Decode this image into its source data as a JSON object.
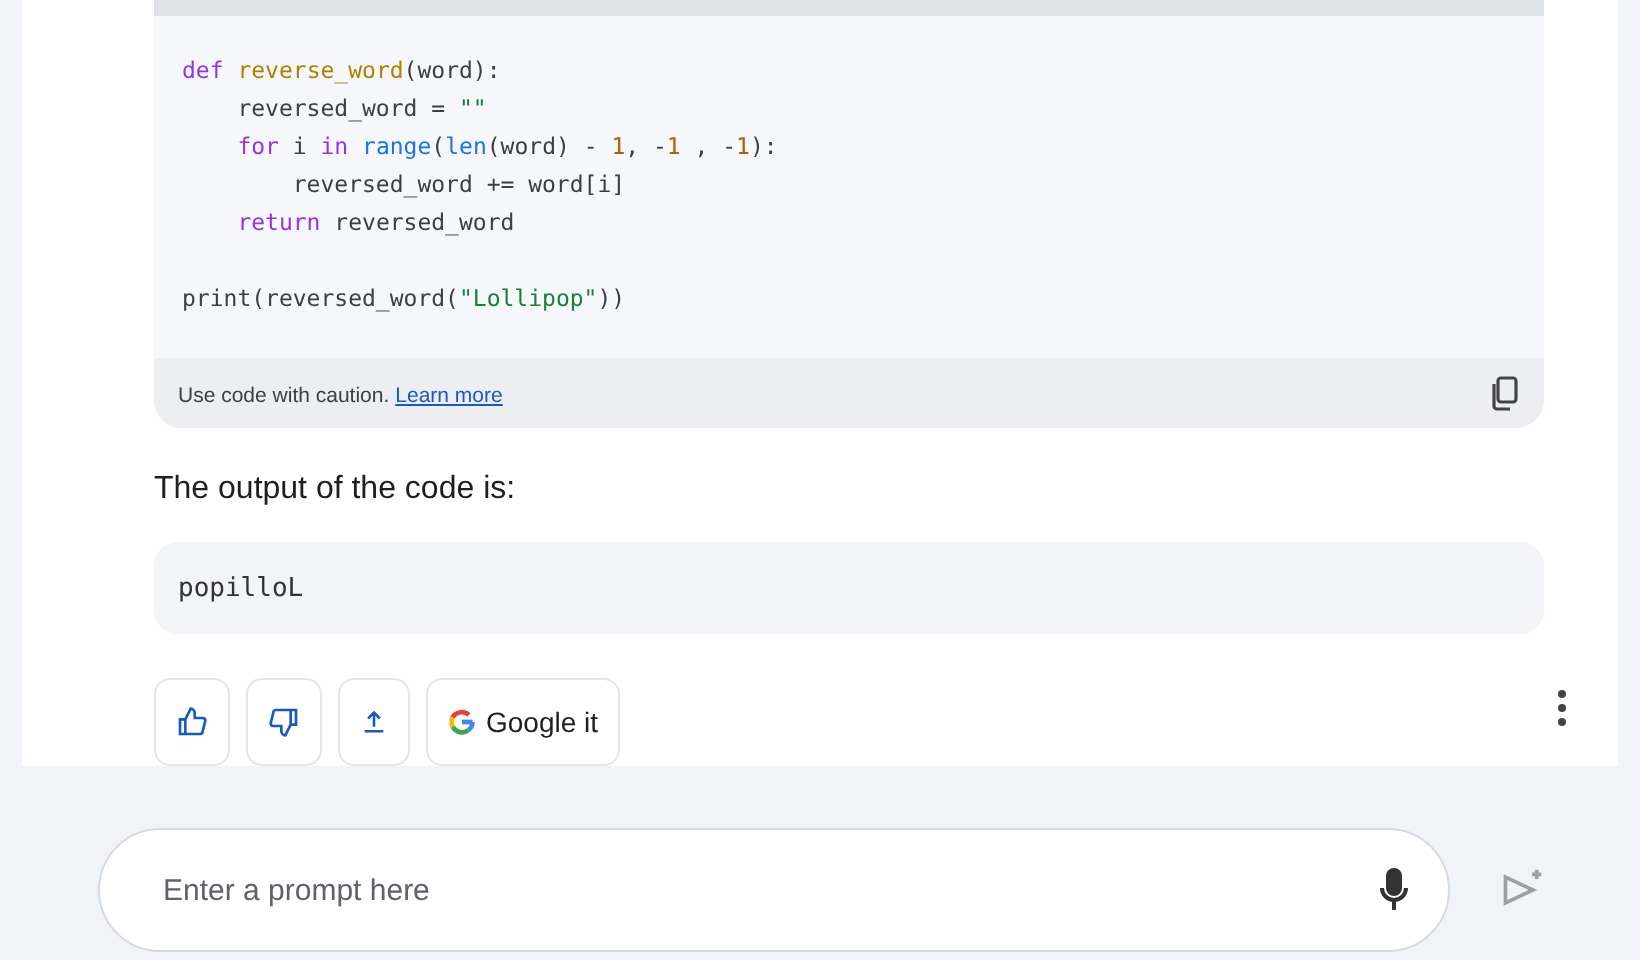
{
  "code_block": {
    "lines": [
      [
        {
          "kind": "keyword",
          "text": "def "
        },
        {
          "kind": "function",
          "text": "reverse_word"
        },
        {
          "kind": "plain",
          "text": "(word):"
        }
      ],
      [
        {
          "kind": "plain",
          "text": "    reversed_word = "
        },
        {
          "kind": "string",
          "text": "\"\""
        }
      ],
      [
        {
          "kind": "keyword",
          "text": "    for "
        },
        {
          "kind": "plain",
          "text": "i "
        },
        {
          "kind": "keyword",
          "text": "in "
        },
        {
          "kind": "builtin",
          "text": "range"
        },
        {
          "kind": "plain",
          "text": "("
        },
        {
          "kind": "builtin",
          "text": "len"
        },
        {
          "kind": "plain",
          "text": "(word) - "
        },
        {
          "kind": "number",
          "text": "1"
        },
        {
          "kind": "plain",
          "text": ", -"
        },
        {
          "kind": "number",
          "text": "1"
        },
        {
          "kind": "plain",
          "text": " , -"
        },
        {
          "kind": "number",
          "text": "1"
        },
        {
          "kind": "plain",
          "text": "):"
        }
      ],
      [
        {
          "kind": "plain",
          "text": "        reversed_word += word[i]"
        }
      ],
      [
        {
          "kind": "keyword",
          "text": "    return "
        },
        {
          "kind": "plain",
          "text": "reversed_word"
        }
      ],
      {
        "kind": "blank"
      },
      [
        {
          "kind": "plain",
          "text": "print(reversed_word("
        },
        {
          "kind": "string",
          "text": "\"Lollipop\""
        },
        {
          "kind": "plain",
          "text": "))"
        }
      ]
    ],
    "caution": "Use code with caution.",
    "learn_more": "Learn more"
  },
  "output_label": "The output of the code is:",
  "output": "popilloL",
  "actions": [
    {
      "kind": "thumb-up"
    },
    {
      "kind": "thumb-down"
    },
    {
      "kind": "share"
    },
    {
      "kind": "google",
      "label": "Google it"
    }
  ],
  "prompt": {
    "placeholder": "Enter a prompt here"
  }
}
